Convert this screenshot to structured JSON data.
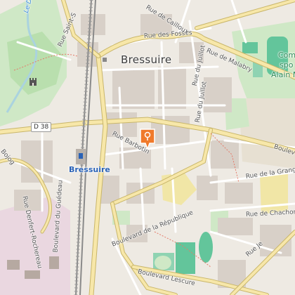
{
  "map": {
    "town": "Bressuire",
    "station": "Bressuire",
    "route_number": "D 38",
    "streets": {
      "rue_saint_s": "Rue Saint-S",
      "rue_des_fosses": "Rue des Fossés",
      "rue_de_malabry": "Rue de Malabry",
      "rue_du_juillot_1": "Rue du Juillot",
      "rue_du_juillot_2": "Rue du Juillot",
      "rue_barbotin": "Rue Barbotin",
      "boulevard_right": "Boulev",
      "rue_de_la_grange": "Rue de la Grange",
      "rue_de_chachon": "Rue de Chachon",
      "rue_denfert_rochereau": "Rue Denfert-Rochereau",
      "boulevard_du_guedeau": "Boulevard du Guédeau",
      "boulevard_de_la_republique": "Boulevard de la République",
      "boulevard_lescure": "Boulevard Lescure",
      "rue_de_cailloux": "Rue de Cailloux",
      "rue_left_bojog": "Bojog",
      "rue_right_bottom": "Rue Je"
    },
    "water": "Le Dolo",
    "park_label_lines": [
      "Com",
      "spo",
      "Alain M"
    ],
    "colors": {
      "background": "#f2efe9",
      "road": "#ffffff",
      "main_road": "#f7e7a9",
      "building": "#d8d0c8",
      "park": "#c9e7c1",
      "sport": "#63c59b",
      "water": "#aad3df",
      "rail": "#8a8a8a",
      "marker": "#f07a2b"
    },
    "marker_icon": "map-pin-icon",
    "monument_icon": "castle-icon"
  }
}
